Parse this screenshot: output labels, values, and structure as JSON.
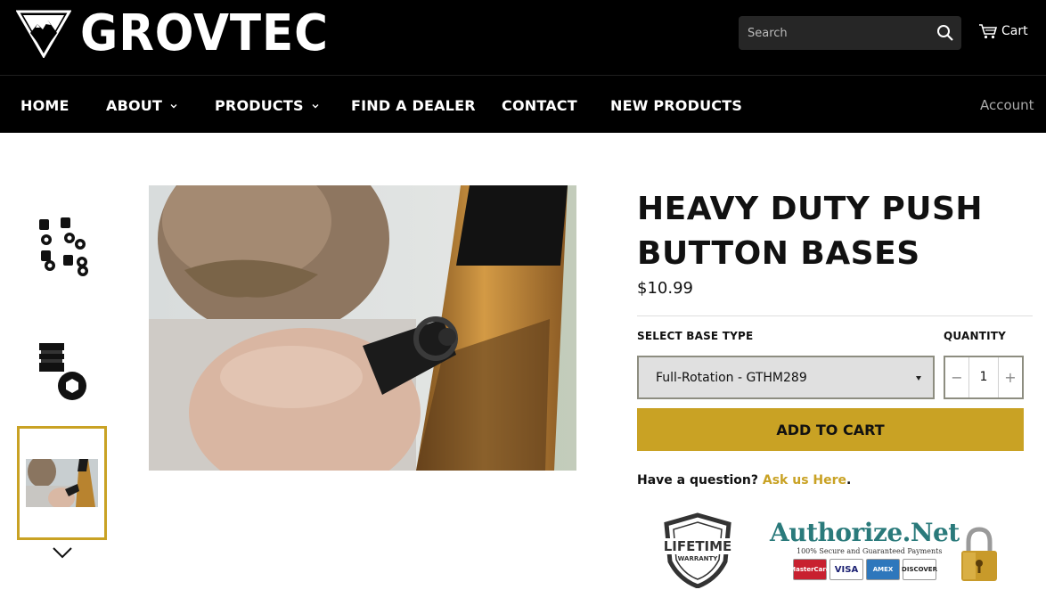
{
  "header": {
    "logo_text": "GROVTEC",
    "search_placeholder": "Search",
    "cart_label": "Cart"
  },
  "nav": {
    "items": [
      {
        "label": "HOME",
        "has_dropdown": false
      },
      {
        "label": "ABOUT",
        "has_dropdown": true
      },
      {
        "label": "PRODUCTS",
        "has_dropdown": true
      },
      {
        "label": "FIND A DEALER",
        "has_dropdown": false
      },
      {
        "label": "CONTACT",
        "has_dropdown": false
      },
      {
        "label": "NEW PRODUCTS",
        "has_dropdown": false
      }
    ],
    "account_label": "Account"
  },
  "product": {
    "title": "HEAVY DUTY PUSH BUTTON BASES",
    "price": "$10.99",
    "base_type_label": "SELECT BASE TYPE",
    "base_type_value": "Full-Rotation - GTHM289",
    "quantity_label": "QUANTITY",
    "quantity_value": "1",
    "add_to_cart_label": "ADD TO CART",
    "question_text": "Have a question? ",
    "question_link": "Ask us Here",
    "question_end": "."
  },
  "badges": {
    "warranty_line1": "LIFETIME",
    "warranty_line2": "WARRANTY",
    "authnet_logo": "Authorize.Net",
    "authnet_sub": "100% Secure and Guaranteed Payments",
    "cards": [
      "MasterCard",
      "VISA",
      "AMEX",
      "DISCOVER"
    ]
  },
  "colors": {
    "accent": "#c9a224",
    "header_bg": "#000000",
    "authnet": "#2a7a7b"
  }
}
